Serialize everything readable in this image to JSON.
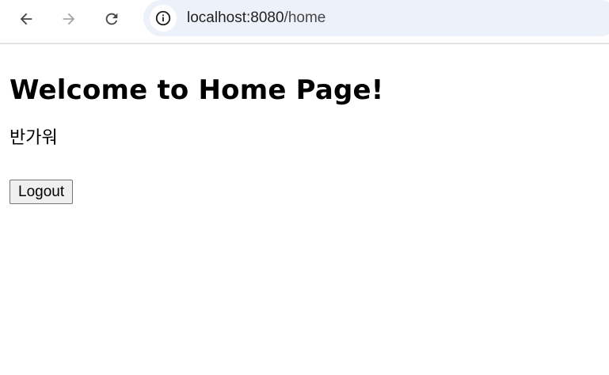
{
  "browser": {
    "url_host": "localhost:8080",
    "url_path": "/home",
    "icons": {
      "back": "arrow-left-icon",
      "forward": "arrow-right-icon",
      "reload": "reload-icon",
      "site_info": "info-icon"
    },
    "colors": {
      "address_bar_bg": "#edf2fa",
      "icon_active": "#474747",
      "icon_disabled": "#a8a8a8"
    }
  },
  "page": {
    "title": "Welcome to Home Page!",
    "greeting": "반가워",
    "logout_label": "Logout"
  }
}
